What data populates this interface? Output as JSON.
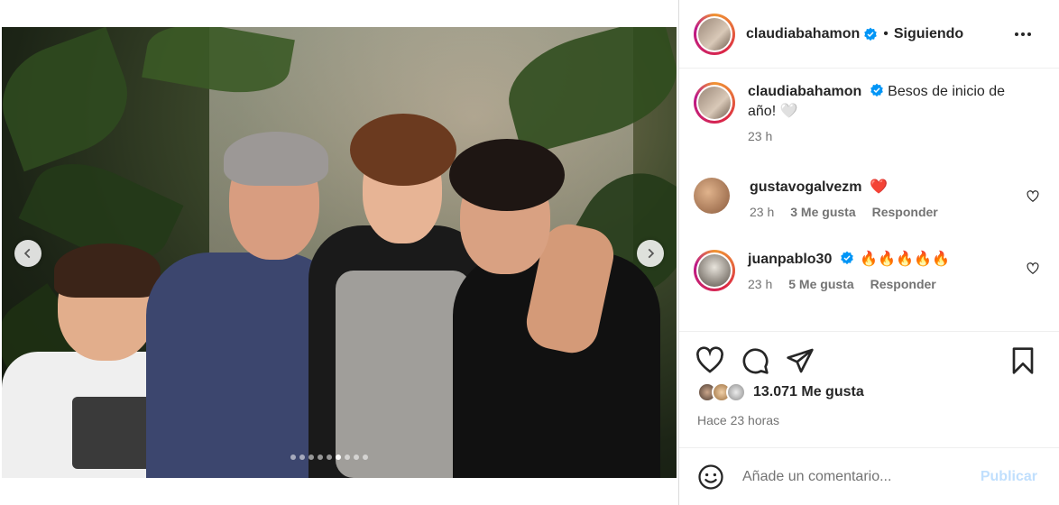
{
  "post": {
    "carousel_dots": 9,
    "active_dot": 5
  },
  "header": {
    "username": "claudiabahamon",
    "separator": "•",
    "follow_status": "Siguiendo",
    "verified_icon": "verified-badge-icon",
    "more_icon": "more-options-icon"
  },
  "caption": {
    "username": "claudiabahamon",
    "text": "Besos de inicio de año! 🤍",
    "time": "23 h"
  },
  "comments": [
    {
      "username": "gustavogalvezm",
      "text": "❤️",
      "time": "23 h",
      "likes": "3 Me gusta",
      "reply": "Responder"
    },
    {
      "username": "juanpablo30",
      "text": "🔥🔥🔥🔥🔥",
      "time": "23 h",
      "likes": "5 Me gusta",
      "reply": "Responder"
    }
  ],
  "actions": {
    "like_icon": "heart-icon",
    "comment_icon": "comment-icon",
    "share_icon": "send-icon",
    "save_icon": "bookmark-icon"
  },
  "likes": {
    "count_text": "13.071 Me gusta",
    "time_ago": "Hace 23 horas"
  },
  "add_comment": {
    "placeholder": "Añade un comentario...",
    "publish_label": "Publicar"
  },
  "colors": {
    "verified": "#0095f6",
    "text_primary": "#262626",
    "text_secondary": "#737373",
    "publish_disabled": "#c0dffd"
  }
}
